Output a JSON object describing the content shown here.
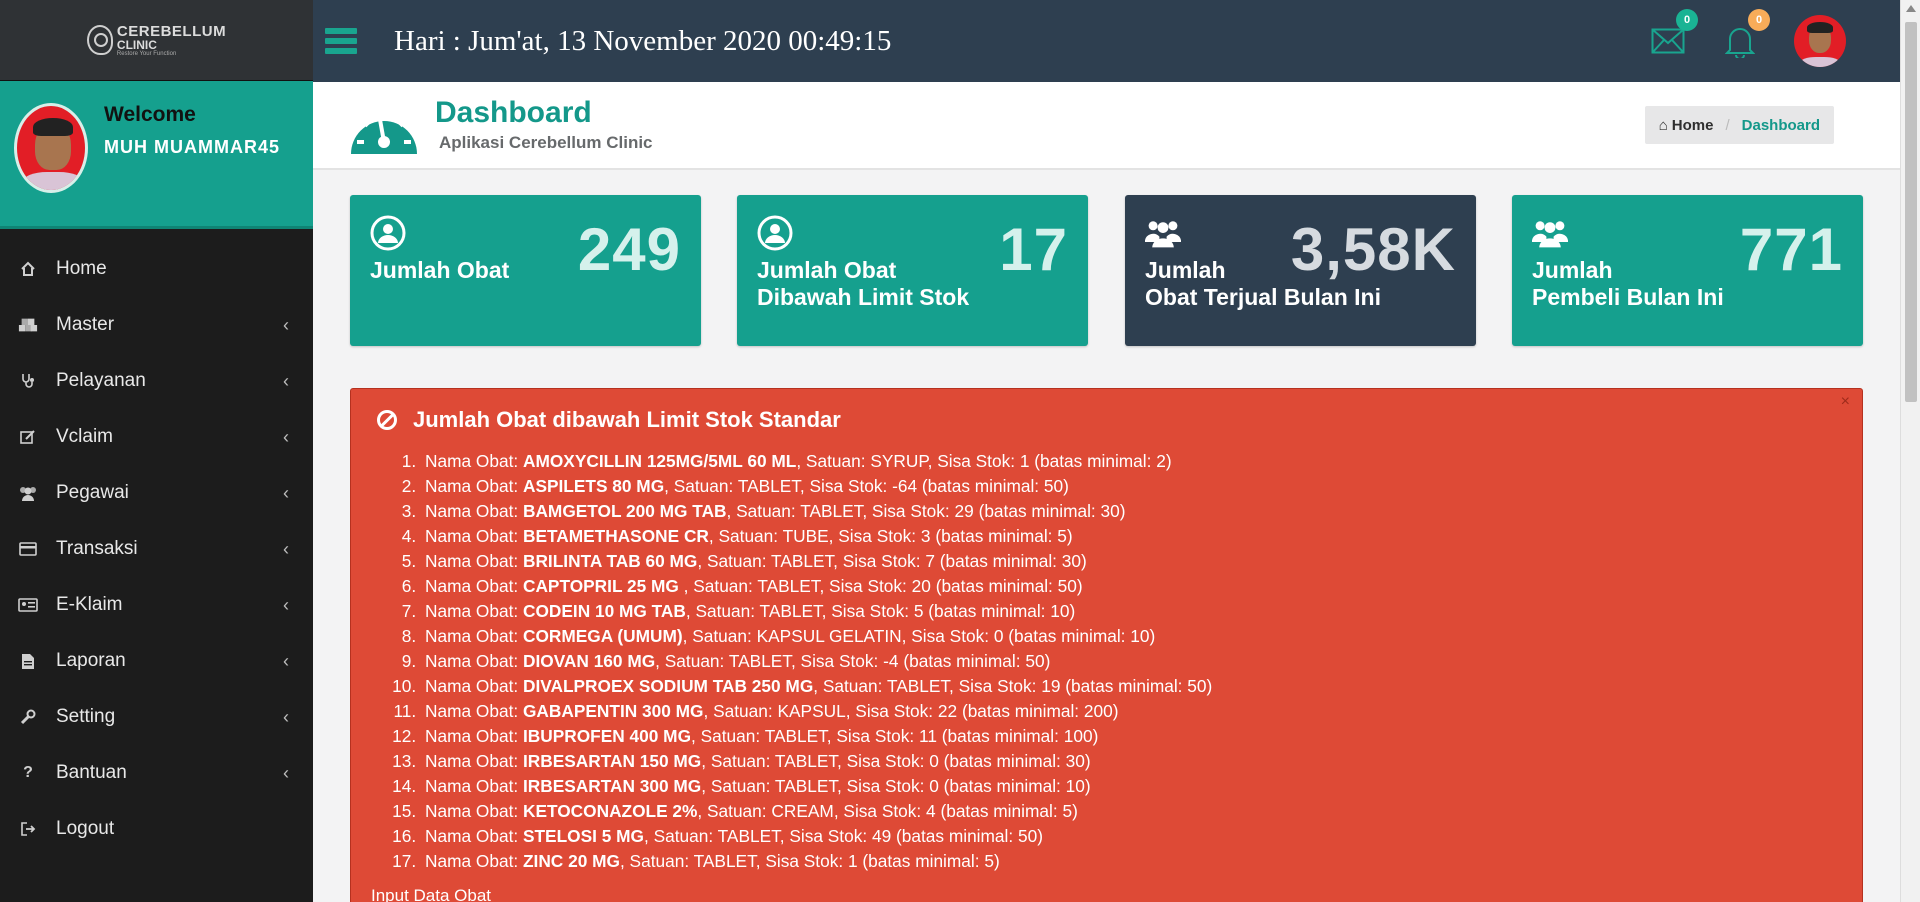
{
  "brand": {
    "line1": "CEREBELLUM",
    "line2": "CLINIC",
    "tagline": "Restore Your Function"
  },
  "user": {
    "welcome": "Welcome",
    "name": "MUH MUAMMAR45"
  },
  "menu": [
    {
      "label": "Home",
      "icon": "home-icon"
    },
    {
      "label": "Master",
      "icon": "cubes-icon"
    },
    {
      "label": "Pelayanan",
      "icon": "stethoscope-icon"
    },
    {
      "label": "Vclaim",
      "icon": "edit-icon"
    },
    {
      "label": "Pegawai",
      "icon": "users-icon"
    },
    {
      "label": "Transaksi",
      "icon": "credit-card-icon"
    },
    {
      "label": "E-Klaim",
      "icon": "id-card-icon"
    },
    {
      "label": "Laporan",
      "icon": "file-icon"
    },
    {
      "label": "Setting",
      "icon": "wrench-icon"
    },
    {
      "label": "Bantuan",
      "icon": "question-icon"
    },
    {
      "label": "Logout",
      "icon": "logout-icon"
    }
  ],
  "topbar": {
    "datetime": "Hari : Jum'at, 13 November 2020 00:49:15",
    "messages_count": "0",
    "notifications_count": "0"
  },
  "heading": {
    "title": "Dashboard",
    "subtitle": "Aplikasi Cerebellum Clinic"
  },
  "breadcrumb": {
    "home": "Home",
    "active": "Dashboard"
  },
  "stats": [
    {
      "label": "Jumlah Obat",
      "value": "249",
      "icon": "user-icon"
    },
    {
      "label": "Jumlah Obat\nDibawah Limit Stok",
      "value": "17",
      "icon": "user-icon"
    },
    {
      "label": "Jumlah\nObat Terjual Bulan Ini",
      "value": "3,58K",
      "icon": "users-icon"
    },
    {
      "label": "Jumlah\nPembeli Bulan Ini",
      "value": "771",
      "icon": "users-icon"
    }
  ],
  "alert": {
    "title": "Jumlah Obat dibawah Limit Stok Standar",
    "close": "×",
    "footer": "Input Data Obat",
    "items": [
      {
        "name": "AMOXYCILLIN 125MG/5ML 60 ML",
        "satuan": "SYRUP",
        "stok": "1",
        "min": "2"
      },
      {
        "name": "ASPILETS 80 MG",
        "satuan": "TABLET",
        "stok": "-64",
        "min": "50"
      },
      {
        "name": "BAMGETOL 200 MG TAB",
        "satuan": "TABLET",
        "stok": "29",
        "min": "30"
      },
      {
        "name": "BETAMETHASONE CR",
        "satuan": "TUBE",
        "stok": "3",
        "min": "5"
      },
      {
        "name": "BRILINTA TAB 60 MG",
        "satuan": "TABLET",
        "stok": "7",
        "min": "30"
      },
      {
        "name": "CAPTOPRIL 25 MG ",
        "satuan": "TABLET",
        "stok": "20",
        "min": "50"
      },
      {
        "name": "CODEIN 10 MG TAB",
        "satuan": "TABLET",
        "stok": "5",
        "min": "10"
      },
      {
        "name": "CORMEGA (UMUM)",
        "satuan": "KAPSUL GELATIN",
        "stok": "0",
        "min": "10"
      },
      {
        "name": "DIOVAN 160 MG",
        "satuan": "TABLET",
        "stok": "-4",
        "min": "50"
      },
      {
        "name": "DIVALPROEX SODIUM TAB 250 MG",
        "satuan": "TABLET",
        "stok": "19",
        "min": "50"
      },
      {
        "name": "GABAPENTIN 300 MG",
        "satuan": "KAPSUL",
        "stok": "22",
        "min": "200"
      },
      {
        "name": "IBUPROFEN 400 MG",
        "satuan": "TABLET",
        "stok": "11",
        "min": "100"
      },
      {
        "name": "IRBESARTAN 150 MG",
        "satuan": "TABLET",
        "stok": "0",
        "min": "30"
      },
      {
        "name": "IRBESARTAN 300 MG",
        "satuan": "TABLET",
        "stok": "0",
        "min": "10"
      },
      {
        "name": "KETOCONAZOLE 2%",
        "satuan": "CREAM",
        "stok": "4",
        "min": "5"
      },
      {
        "name": "STELOSI 5 MG",
        "satuan": "TABLET",
        "stok": "49",
        "min": "50"
      },
      {
        "name": "ZINC 20 MG",
        "satuan": "TABLET",
        "stok": "1",
        "min": "5"
      }
    ]
  },
  "colors": {
    "teal": "#15a08e",
    "navy": "#2e3f50",
    "danger": "#de4a36",
    "sidebar": "#1c1c1c"
  }
}
